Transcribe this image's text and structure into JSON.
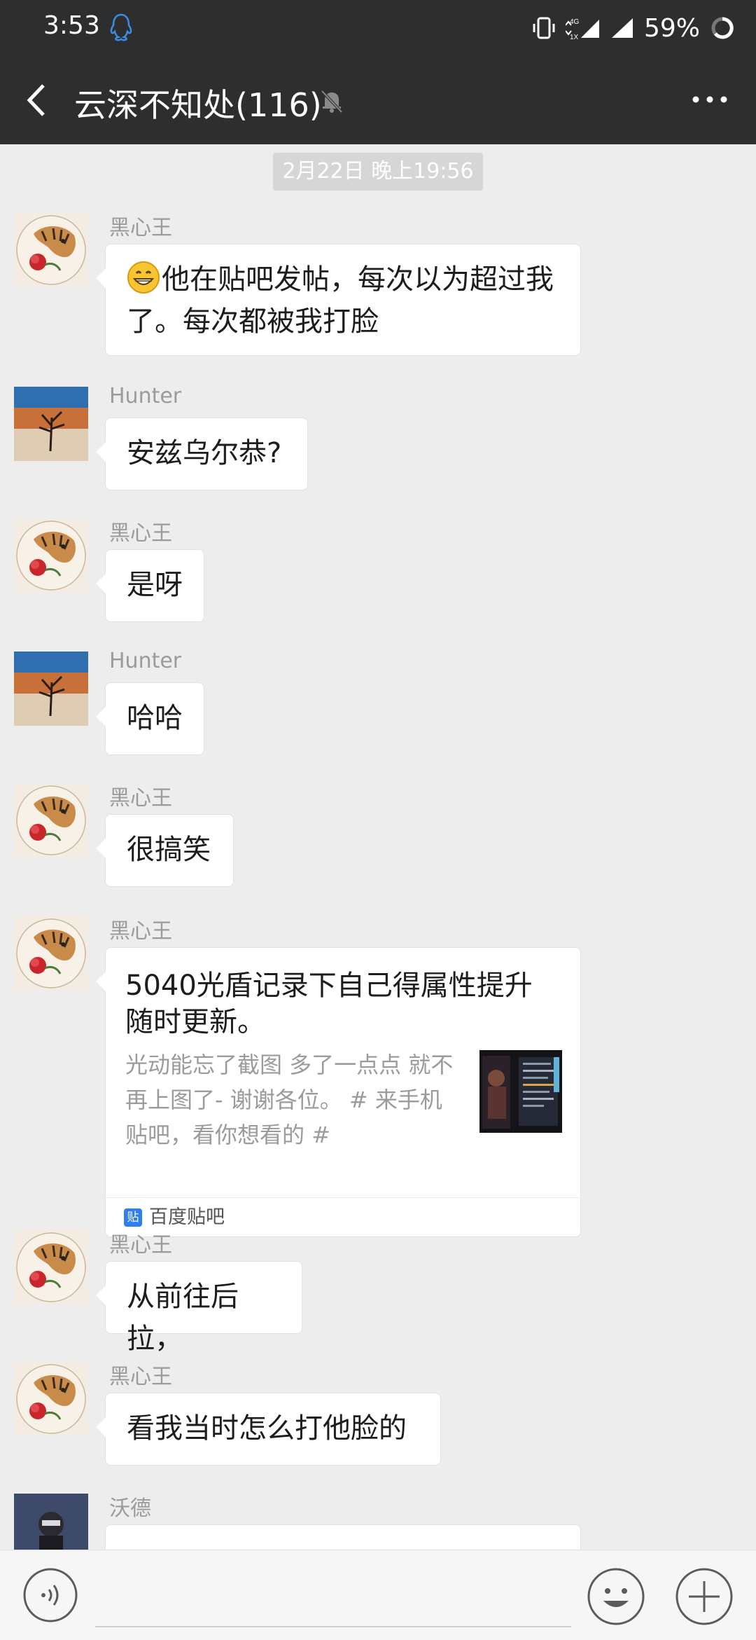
{
  "status_bar": {
    "time": "3:53",
    "network": "4G",
    "battery": "59%"
  },
  "header": {
    "title": "云深不知处(116)"
  },
  "timestamp": "2月22日 晚上19:56",
  "messages": [
    {
      "sender": "黑心王",
      "text": "他在贴吧发帖，每次以为超过我了。每次都被我打脸"
    },
    {
      "sender": "Hunter",
      "text": "安兹乌尔恭?"
    },
    {
      "sender": "黑心王",
      "text": "是呀"
    },
    {
      "sender": "Hunter",
      "text": "哈哈"
    },
    {
      "sender": "黑心王",
      "text": "很搞笑"
    },
    {
      "sender": "黑心王",
      "card": {
        "title": "5040光盾记录下自己得属性提升随时更新。",
        "description": "光动能忘了截图 多了一点点 就不再上图了- 谢谢各位。 # 来手机贴吧，看你想看的 #",
        "source": "百度贴吧",
        "source_icon": "贴"
      }
    },
    {
      "sender": "黑心王",
      "text": "从前往后拉，"
    },
    {
      "sender": "黑心王",
      "text": "看我当时怎么打他脸的"
    },
    {
      "sender": "沃德",
      "text": ""
    }
  ],
  "colors": {
    "bar_bg": "#2e2e2e",
    "chat_bg": "#ededed",
    "bubble_bg": "#ffffff",
    "sender_color": "#9b9b9b"
  }
}
